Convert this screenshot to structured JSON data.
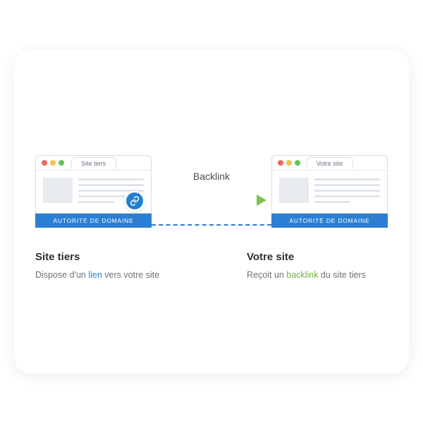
{
  "arrow_label": "Backlink",
  "left": {
    "tab": "Site tiers",
    "authority": "AUTORITÉ DE DOMAINE",
    "title": "Site tiers",
    "desc_pre": "Dispose d'un ",
    "desc_hl": "lien",
    "desc_post": " vers votre site"
  },
  "right": {
    "tab": "Votre site",
    "authority": "AUTORITÉ DE DOMAINE",
    "title": "Votre site",
    "desc_pre": "Reçoit un ",
    "desc_hl": "backlink",
    "desc_post": " du site tiers"
  }
}
